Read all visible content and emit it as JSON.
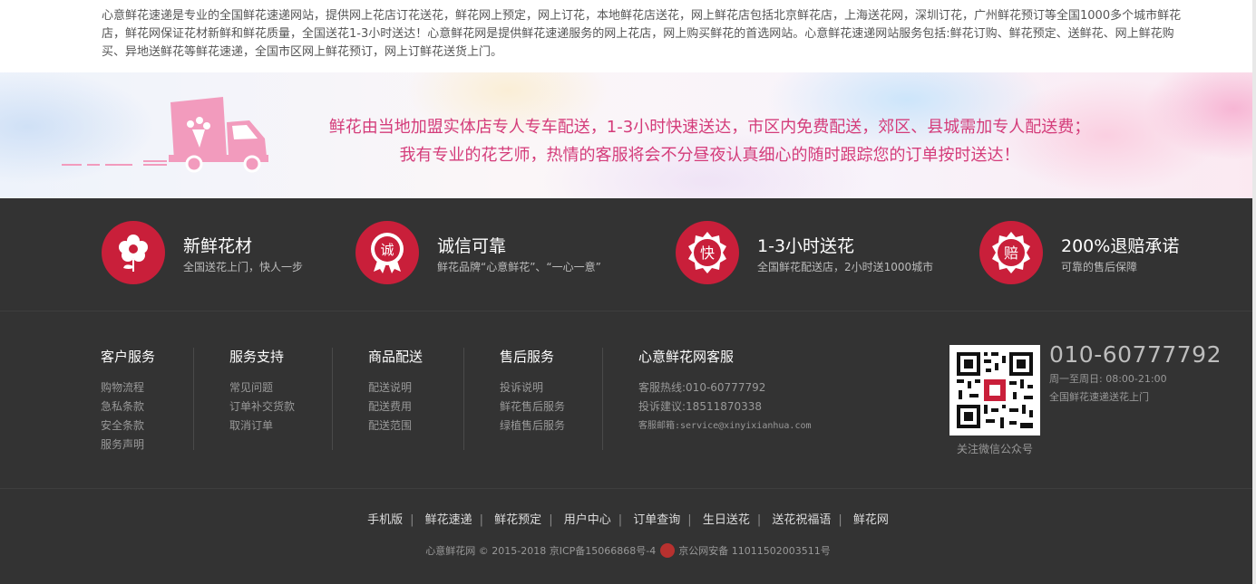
{
  "intro": {
    "text": "心意鲜花速递是专业的全国鲜花速递网站，提供网上花店订花送花，鲜花网上预定，网上订花，本地鲜花店送花，网上鲜花店包括北京鲜花店，上海送花网，深圳订花，广州鲜花预订等全国1000多个城市鲜花店，鲜花网保证花材新鲜和鲜花质量，全国送花1-3小时送达！心意鲜花网是提供鲜花速递服务的网上花店，网上购买鲜花的首选网站。心意鲜花速递网站服务包括:鲜花订购、鲜花预定、送鲜花、网上鲜花购买、异地送鲜花等鲜花速递，全国市区网上鲜花预订，网上订鲜花送货上门。"
  },
  "banner": {
    "line1": "鲜花由当地加盟实体店专人专车配送，1-3小时快速送达，市区内免费配送，郊区、县城需加专人配送费；",
    "line2": "我有专业的花艺师，热情的客服将会不分昼夜认真细心的随时跟踪您的订单按时送达！"
  },
  "features": [
    {
      "icon": "flower-icon",
      "title": "新鲜花材",
      "desc": "全国送花上门，快人一步"
    },
    {
      "icon": "seal-icon",
      "glyph": "诚",
      "title": "诚信可靠",
      "desc": "鲜花品牌“心意鲜花”、“一心一意”"
    },
    {
      "icon": "fast-icon",
      "glyph": "快",
      "title": "1-3小时送花",
      "desc": "全国鲜花配送店，2小时送1000城市"
    },
    {
      "icon": "compensation-icon",
      "glyph": "赔",
      "title": "200%退赔承诺",
      "desc": "可靠的售后保障"
    }
  ],
  "columns": [
    {
      "title": "客户服务",
      "links": [
        "购物流程",
        "急私条款",
        "安全条款",
        "服务声明"
      ]
    },
    {
      "title": "服务支持",
      "links": [
        "常见问题",
        "订单补交货款",
        "取消订单"
      ]
    },
    {
      "title": "商品配送",
      "links": [
        "配送说明",
        "配送费用",
        "配送范围"
      ]
    },
    {
      "title": "售后服务",
      "links": [
        "投诉说明",
        "鲜花售后服务",
        "绿植售后服务"
      ]
    },
    {
      "title": "心意鲜花网客服",
      "links": [
        "客服热线:010-60777792",
        "投诉建议:18511870338",
        "客服邮箱:service@xinyixianhua.com"
      ]
    }
  ],
  "contact": {
    "phone": "010-60777792",
    "hours": "周一至周日: 08:00-21:00",
    "note": "全国鲜花速递送花上门",
    "qr_caption": "关注微信公众号"
  },
  "bottom_links": [
    "手机版",
    "鲜花速递",
    "鲜花预定",
    "用户中心",
    "订单查询",
    "生日送花",
    "送花祝福语",
    "鲜花网"
  ],
  "copyright": {
    "left": "心意鲜花网 © 2015-2018 京ICP备15066868号-4",
    "right": "京公网安备 11011502003511号"
  }
}
